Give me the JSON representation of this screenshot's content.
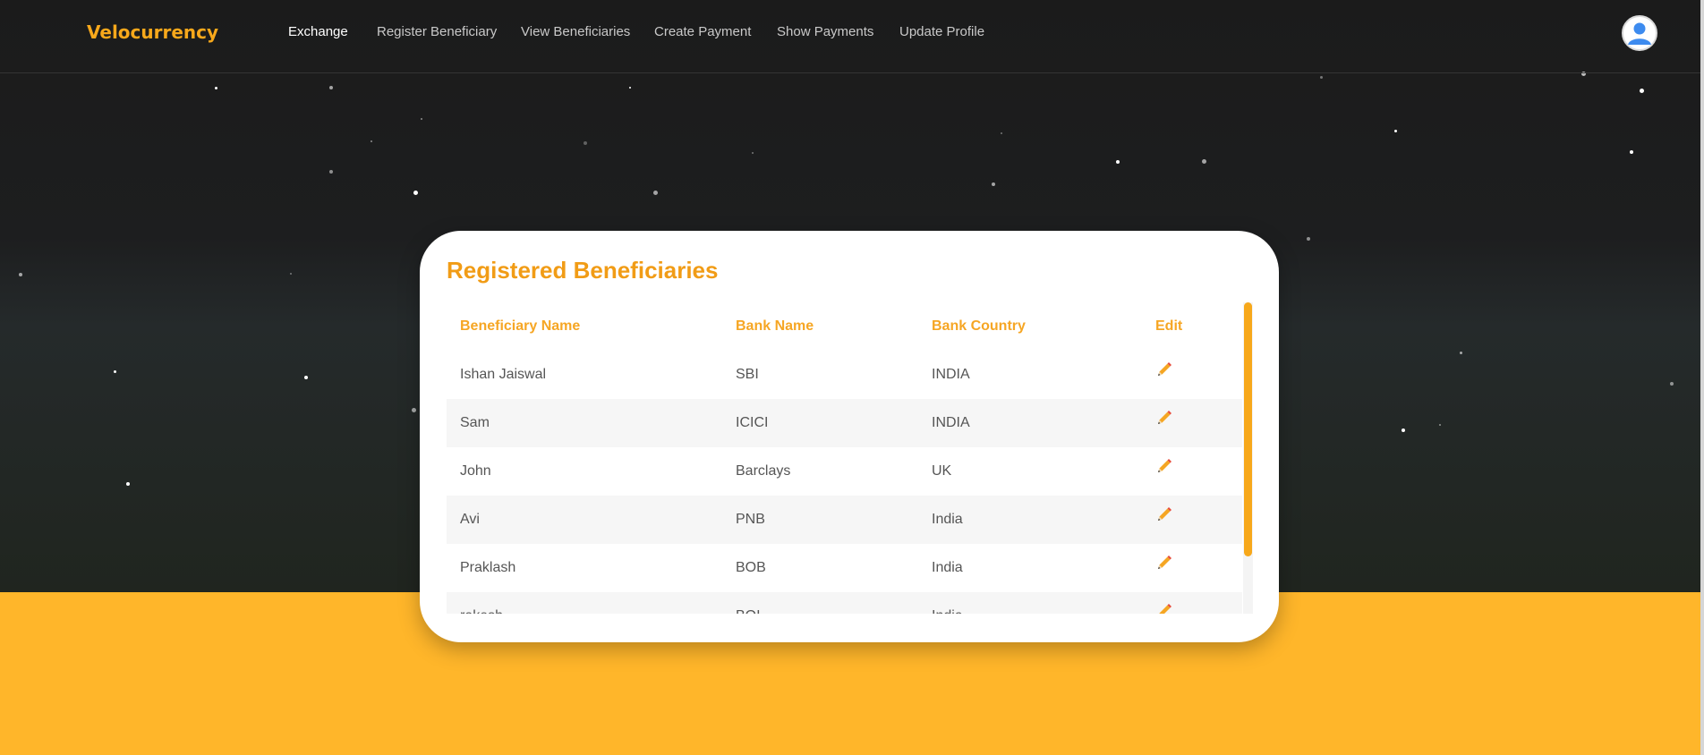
{
  "navbar": {
    "brand": "Velocurrency",
    "links": [
      {
        "label": "Exchange",
        "active": true
      },
      {
        "label": "Register Beneficiary",
        "active": false
      },
      {
        "label": "View Beneficiaries",
        "active": false
      },
      {
        "label": "Create Payment",
        "active": false
      },
      {
        "label": "Show Payments",
        "active": false
      },
      {
        "label": "Update Profile",
        "active": false
      }
    ],
    "avatar_icon": "user-avatar-icon"
  },
  "card": {
    "title": "Registered Beneficiaries",
    "columns": [
      "Beneficiary Name",
      "Bank Name",
      "Bank Country",
      "Edit"
    ],
    "rows": [
      {
        "name": "Ishan Jaiswal",
        "bank": "SBI",
        "country": "INDIA"
      },
      {
        "name": "Sam",
        "bank": "ICICI",
        "country": "INDIA"
      },
      {
        "name": "John",
        "bank": "Barclays",
        "country": "UK"
      },
      {
        "name": "Avi",
        "bank": "PNB",
        "country": "India"
      },
      {
        "name": "Praklash",
        "bank": "BOB",
        "country": "India"
      },
      {
        "name": "rakesh",
        "bank": "BOI",
        "country": "India"
      }
    ],
    "edit_icon": "pencil-icon"
  },
  "colors": {
    "accent": "#f7a81b",
    "ground": "#ffb62a",
    "background": "#1c1c1c"
  }
}
